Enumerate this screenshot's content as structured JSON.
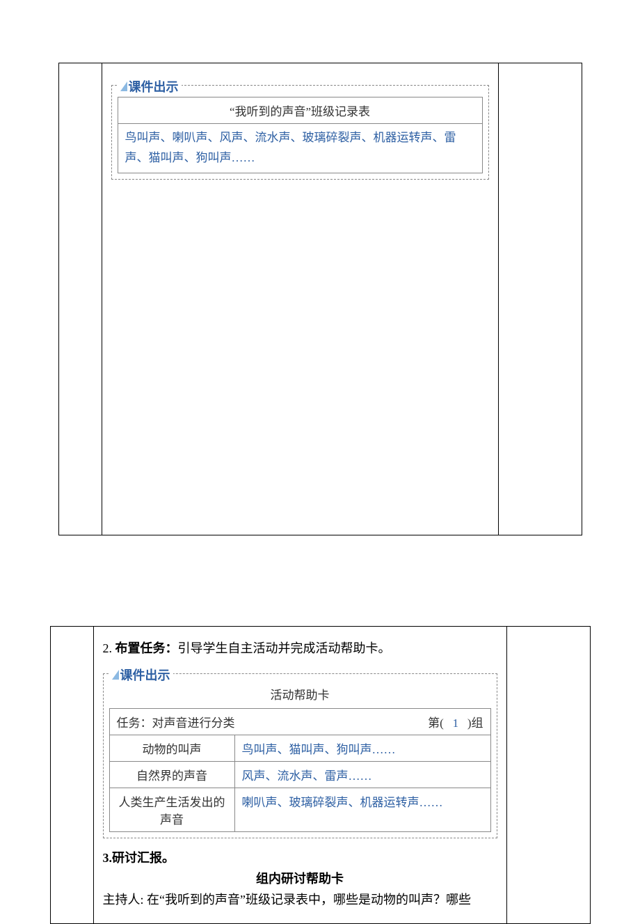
{
  "block1": {
    "courseware_label": "课件出示",
    "table_title": "“我听到的声音”班级记录表",
    "table_content": "鸟叫声、喇叭声、风声、流水声、玻璃碎裂声、机器运转声、雷声、猫叫声、狗叫声……"
  },
  "block2": {
    "task_number": "2.",
    "task_label": "布置任务：",
    "task_body": "引导学生自主活动并完成活动帮助卡。",
    "courseware_label": "课件出示",
    "help_title": "活动帮助卡",
    "head_task_label": "任务：对声音进行分类",
    "head_group_prefix": "第(",
    "head_group_number": "1",
    "head_group_suffix": ")组",
    "rows": [
      {
        "category": "动物的叫声",
        "examples": "鸟叫声、猫叫声、狗叫声……"
      },
      {
        "category": "自然界的声音",
        "examples": "风声、流水声、雷声……"
      },
      {
        "category": "人类生产生活发出的声音",
        "examples": "喇叭声、玻璃碎裂声、机器运转声……"
      }
    ],
    "section3_heading": "3.研讨汇报。",
    "group_card_heading": "组内研讨帮助卡",
    "host_line": "主持人: 在“我听到的声音”班级记录表中，哪些是动物的叫声？哪些"
  }
}
